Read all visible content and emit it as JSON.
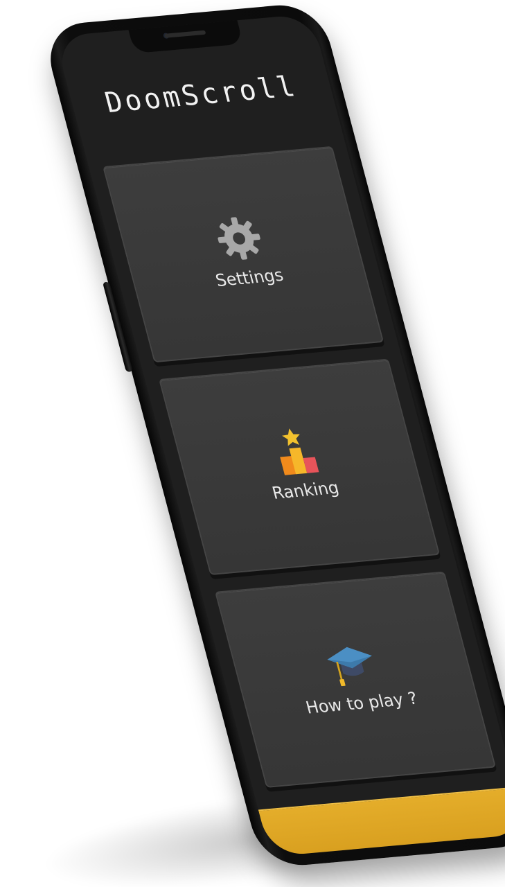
{
  "app": {
    "title": "DoomScroll"
  },
  "menu": {
    "items": [
      {
        "label": "Settings",
        "icon": "gear-icon"
      },
      {
        "label": "Ranking",
        "icon": "podium-star-icon"
      },
      {
        "label": "How to play ?",
        "icon": "graduation-cap-icon"
      }
    ]
  },
  "colors": {
    "background": "#1f1f1f",
    "card": "#3a3a3a",
    "accent": "#dca524",
    "text": "#e8e8e8"
  }
}
